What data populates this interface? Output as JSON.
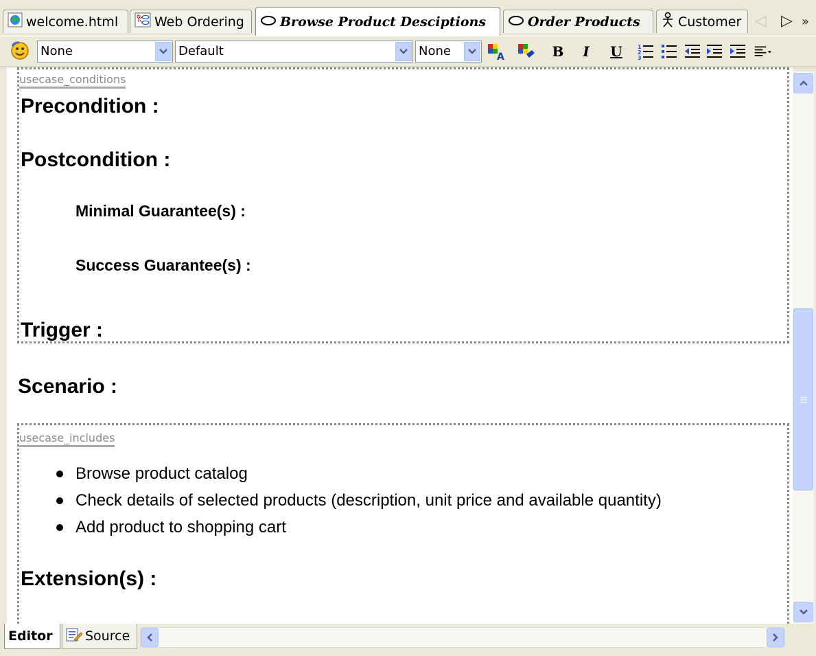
{
  "tabs": [
    {
      "label": "welcome.html",
      "icon": "html-page-icon",
      "active": false
    },
    {
      "label": "Web Ordering",
      "icon": "use-case-diagram-icon",
      "active": false
    },
    {
      "label": "Browse Product Desciptions",
      "icon": "use-case-oval-icon",
      "active": true
    },
    {
      "label": "Order Products",
      "icon": "use-case-oval-icon",
      "active": false
    },
    {
      "label": "Customer",
      "icon": "actor-icon",
      "active": false
    }
  ],
  "toolbar": {
    "style_select": "None",
    "font_select": "Default",
    "size_select": "None",
    "bold_label": "B",
    "italic_label": "I",
    "underline_label": "U"
  },
  "document": {
    "region_conditions_tag": "usecase_conditions",
    "precondition": "Precondition :",
    "postcondition": "Postcondition :",
    "minimal_guarantee": "Minimal Guarantee(s) :",
    "success_guarantee": "Success Guarantee(s) :",
    "trigger": "Trigger :",
    "scenario": "Scenario :",
    "region_includes_tag": "usecase_includes",
    "includes": [
      "Browse product catalog",
      "Check details of selected products (description, unit price and available quantity)",
      "Add product to shopping cart"
    ],
    "extensions": "Extension(s) :"
  },
  "bottom_tabs": [
    {
      "label": "Editor",
      "active": true
    },
    {
      "label": "Source",
      "active": false,
      "icon": "source-edit-icon"
    }
  ],
  "colors": {
    "chrome": "#ece9d8",
    "scroll_blue": "#c4d3fb",
    "region_border": "#8a8a8a"
  }
}
